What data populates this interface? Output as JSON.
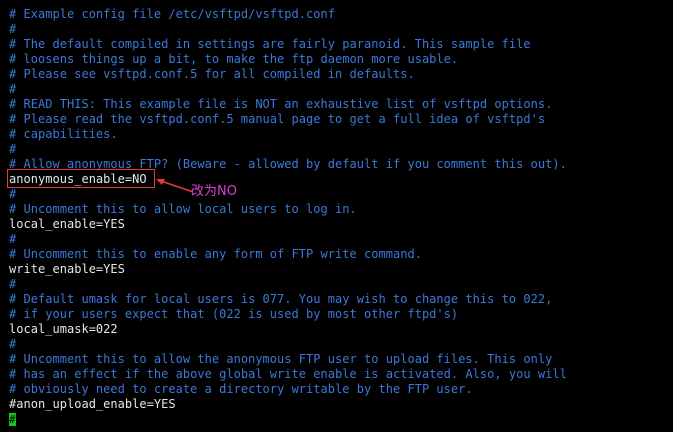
{
  "lines": [
    {
      "text": "# Example config file /etc/vsftpd/vsftpd.conf",
      "kind": "comment"
    },
    {
      "text": "#",
      "kind": "comment"
    },
    {
      "text": "# The default compiled in settings are fairly paranoid. This sample file",
      "kind": "comment"
    },
    {
      "text": "# loosens things up a bit, to make the ftp daemon more usable.",
      "kind": "comment"
    },
    {
      "text": "# Please see vsftpd.conf.5 for all compiled in defaults.",
      "kind": "comment"
    },
    {
      "text": "#",
      "kind": "comment"
    },
    {
      "text": "# READ THIS: This example file is NOT an exhaustive list of vsftpd options.",
      "kind": "comment"
    },
    {
      "text": "# Please read the vsftpd.conf.5 manual page to get a full idea of vsftpd's",
      "kind": "comment"
    },
    {
      "text": "# capabilities.",
      "kind": "comment"
    },
    {
      "text": "#",
      "kind": "comment"
    },
    {
      "text": "# Allow anonymous FTP? (Beware - allowed by default if you comment this out).",
      "kind": "comment"
    },
    {
      "text": "anonymous_enable=NO",
      "kind": "setting"
    },
    {
      "text": "#",
      "kind": "comment"
    },
    {
      "text": "# Uncomment this to allow local users to log in.",
      "kind": "comment"
    },
    {
      "text": "local_enable=YES",
      "kind": "setting"
    },
    {
      "text": "#",
      "kind": "comment"
    },
    {
      "text": "# Uncomment this to enable any form of FTP write command.",
      "kind": "comment"
    },
    {
      "text": "write_enable=YES",
      "kind": "setting"
    },
    {
      "text": "#",
      "kind": "comment"
    },
    {
      "text": "# Default umask for local users is 077. You may wish to change this to 022,",
      "kind": "comment"
    },
    {
      "text": "# if your users expect that (022 is used by most other ftpd's)",
      "kind": "comment"
    },
    {
      "text": "local_umask=022",
      "kind": "setting"
    },
    {
      "text": "#",
      "kind": "comment"
    },
    {
      "text": "# Uncomment this to allow the anonymous FTP user to upload files. This only",
      "kind": "comment"
    },
    {
      "text": "# has an effect if the above global write enable is activated. Also, you will",
      "kind": "comment"
    },
    {
      "text": "# obviously need to create a directory writable by the FTP user.",
      "kind": "comment"
    },
    {
      "text": "#anon_upload_enable=YES",
      "kind": "setting"
    }
  ],
  "cursor_line": "#",
  "annotation": {
    "text": "改为NO",
    "color": "#d040d0",
    "box_color": "#e53b3b"
  },
  "colors": {
    "background": "#000000",
    "comment": "#3b78d9",
    "setting": "#e6e6e6",
    "cursor": "#19c419"
  }
}
